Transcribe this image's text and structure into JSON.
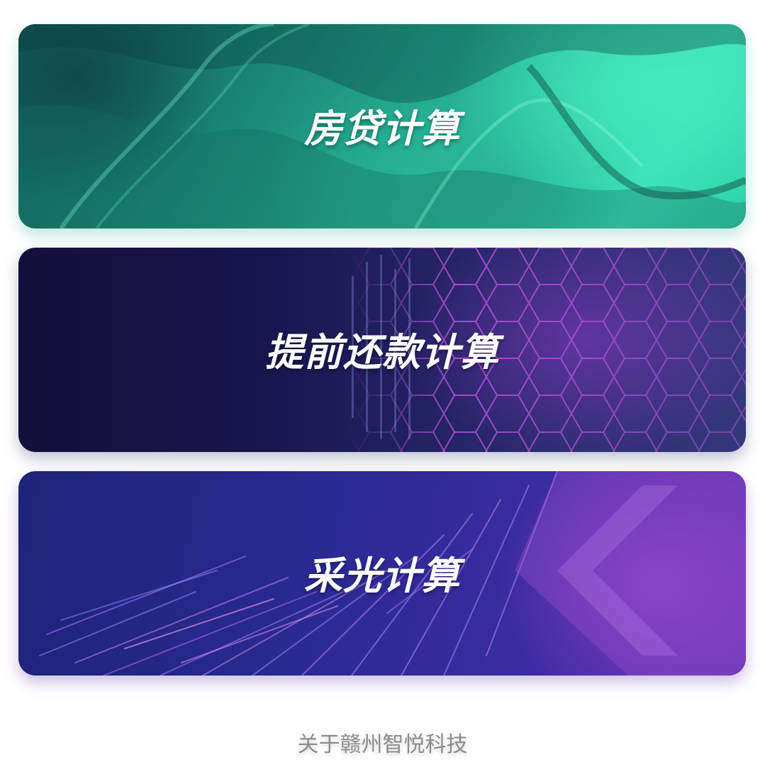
{
  "cards": [
    {
      "title": "房贷计算"
    },
    {
      "title": "提前还款计算"
    },
    {
      "title": "采光计算"
    }
  ],
  "footer": {
    "about_link": "关于赣州智悦科技"
  },
  "colors": {
    "mortgage_card": "#27b595",
    "prepayment_card": "#1a1650",
    "lighting_card": "#2a2a92",
    "footer_text": "#8d8d8d"
  }
}
